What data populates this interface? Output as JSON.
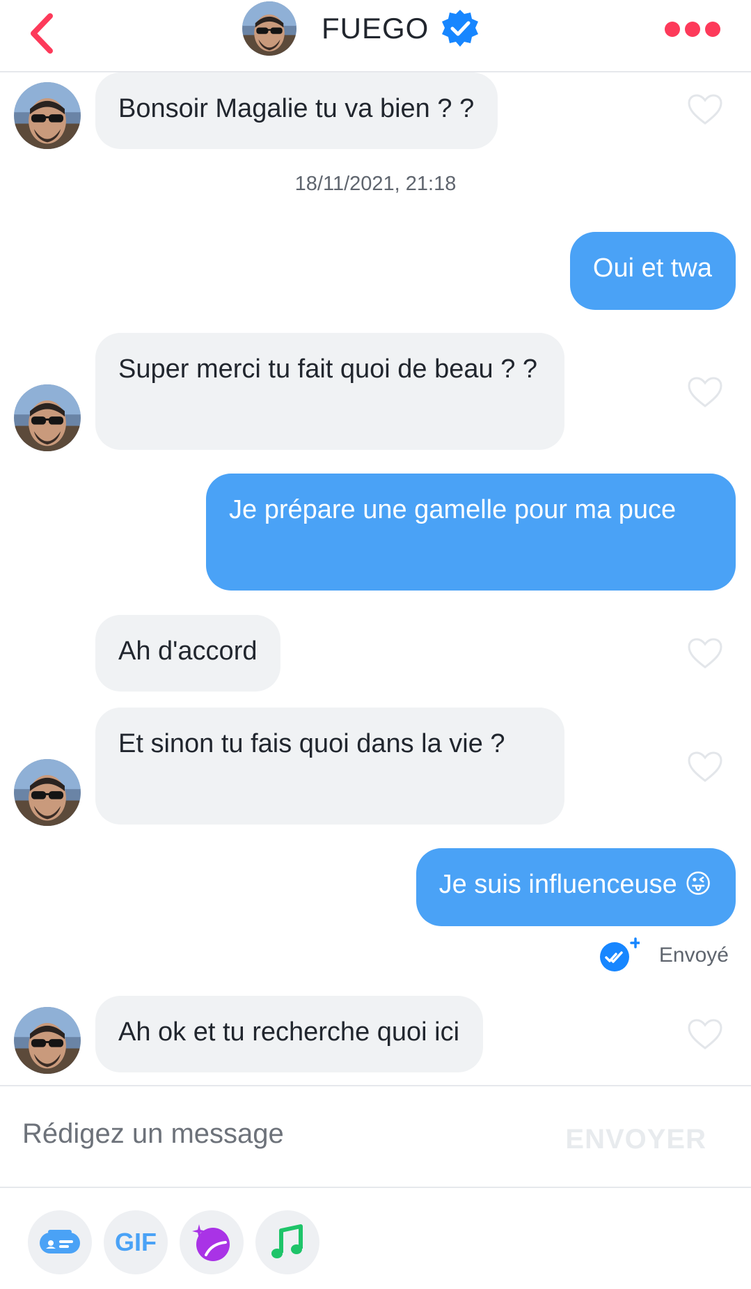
{
  "header": {
    "back_icon": "chevron-left-icon",
    "name": "FUEGO",
    "verified_icon": "verified-badge-icon",
    "more_icon": "more-dots-icon",
    "accent_color": "#fd3a5a"
  },
  "timestamp": "18/11/2021, 21:18",
  "messages": [
    {
      "direction": "in",
      "text": "Bonsoir Magalie tu va bien ? ?"
    },
    {
      "direction": "out",
      "text": "Oui et twa"
    },
    {
      "direction": "in",
      "text": "Super merci tu fait quoi de beau ? ?"
    },
    {
      "direction": "out",
      "text": "Je prépare une gamelle pour ma puce"
    },
    {
      "direction": "in",
      "text": "Ah d'accord"
    },
    {
      "direction": "in",
      "text": "Et sinon tu fais quoi dans la vie ?"
    },
    {
      "direction": "out",
      "text": "Je suis influenceuse 😜"
    },
    {
      "direction": "in",
      "text": "Ah ok et tu recherche quoi ici"
    }
  ],
  "sent_status": {
    "label": "Envoyé",
    "icon": "read-receipt-icon"
  },
  "composer": {
    "placeholder": "Rédigez un message",
    "send_label": "ENVOYER"
  },
  "tools": {
    "gif_label": "GIF",
    "icons": [
      "contact-card-icon",
      "gif-icon",
      "sticker-icon",
      "music-note-icon"
    ]
  },
  "colors": {
    "incoming_bubble": "#f0f2f4",
    "outgoing_bubble": "#4aa2f6",
    "verified": "#1786ff",
    "sticker": "#a933e6",
    "music": "#1ec469"
  }
}
